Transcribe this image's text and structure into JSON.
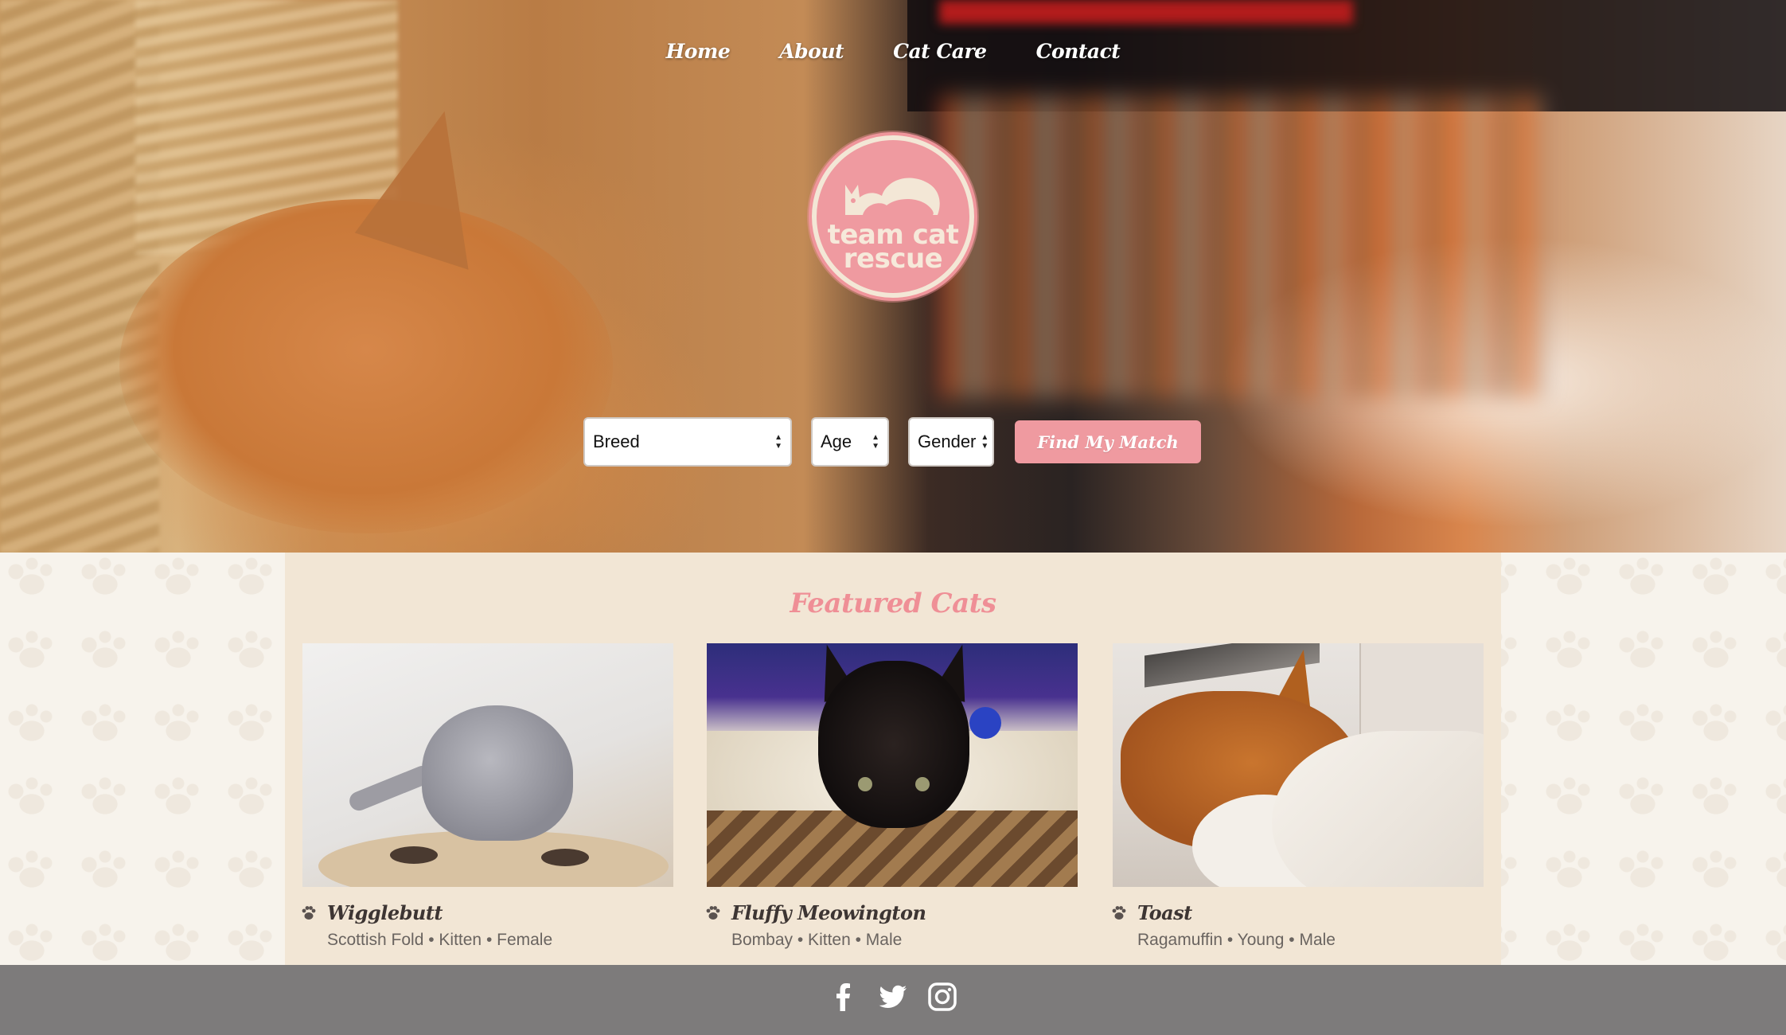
{
  "nav": {
    "items": [
      {
        "label": "Home"
      },
      {
        "label": "About"
      },
      {
        "label": "Cat Care"
      },
      {
        "label": "Contact"
      }
    ]
  },
  "logo": {
    "line1": "team cat",
    "line2": "rescue",
    "color": "#ef9aa0"
  },
  "search": {
    "breed": "Breed",
    "age": "Age",
    "gender": "Gender",
    "button": "Find My Match"
  },
  "featured": {
    "title": "Featured Cats",
    "cats": [
      {
        "name": "Wigglebutt",
        "meta": "Scottish Fold • Kitten • Female"
      },
      {
        "name": "Fluffy Meowington",
        "meta": "Bombay • Kitten • Male"
      },
      {
        "name": "Toast",
        "meta": "Ragamuffin • Young • Male"
      }
    ]
  },
  "footer": {
    "icons": [
      "facebook-icon",
      "twitter-icon",
      "instagram-icon"
    ]
  },
  "colors": {
    "accent": "#ef9aa0",
    "panel": "#f2e6d5",
    "footer": "#7d7b7b"
  }
}
